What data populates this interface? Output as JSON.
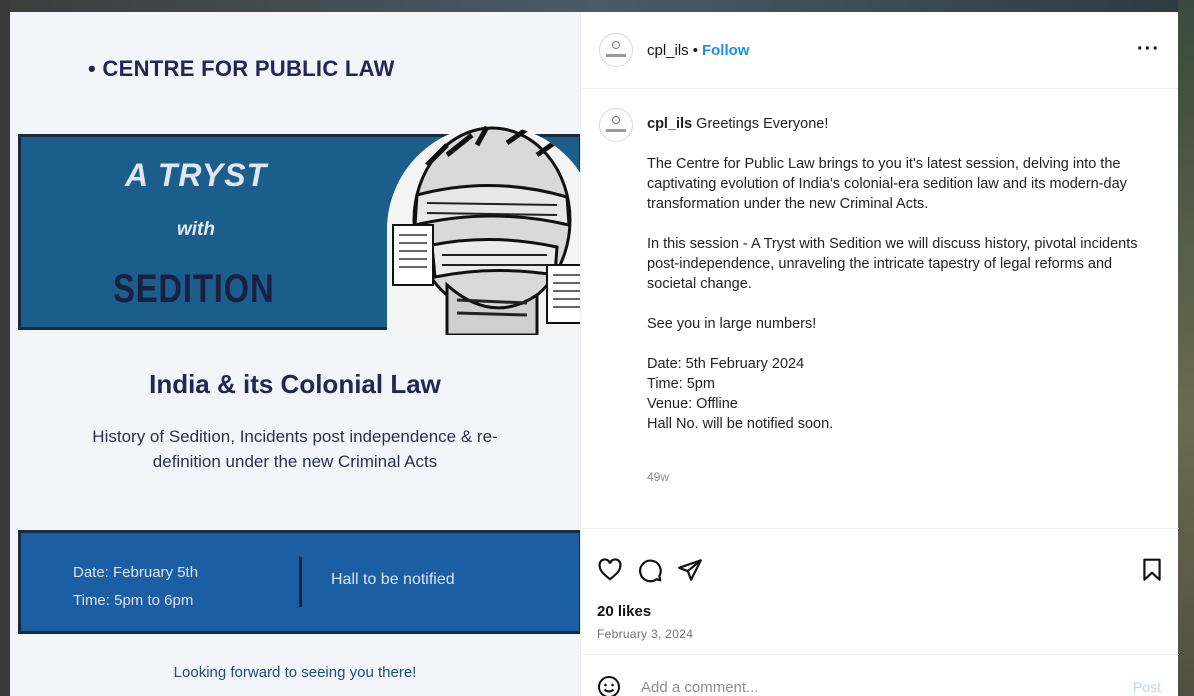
{
  "poster": {
    "header": "• CENTRE FOR PUBLIC LAW",
    "tryst": "A TRYST",
    "with": "with",
    "sedition": "SEDITION",
    "title": "India & its Colonial Law",
    "subtitle_line1": "History of Sedition, Incidents post independence & re-",
    "subtitle_line2": "definition under the new Criminal Acts",
    "date": "Date: February 5th",
    "time": "Time: 5pm to 6pm",
    "hall": "Hall to be notified",
    "footer": "Looking forward to seeing you there!"
  },
  "post": {
    "username": "cpl_ils",
    "follow_label": "Follow",
    "more_label": "···",
    "caption": {
      "username": "cpl_ils",
      "greeting": "Greetings Everyone!",
      "para1": "The Centre for Public Law brings to you it's latest session, delving into the captivating evolution of India's colonial-era sedition law and its modern-day transformation under the new Criminal Acts.",
      "para2": "In this session - A Tryst with Sedition we will discuss history, pivotal incidents post-independence, unraveling the intricate tapestry of legal reforms and societal change.",
      "para3": "See you in large numbers!",
      "date": "Date: 5th February 2024",
      "time": "Time: 5pm",
      "venue": "Venue: Offline",
      "hall": "Hall No. will be notified soon."
    },
    "age": "49w",
    "likes": "20 likes",
    "date": "February 3, 2024",
    "comment_placeholder": "Add a comment...",
    "post_label": "Post"
  },
  "icons": [
    "heart-icon",
    "comment-icon",
    "share-icon",
    "bookmark-icon",
    "emoji-icon"
  ],
  "colors": {
    "follow": "#1d8ee6",
    "banner": "#1b5e8c",
    "info_bar": "#1b5ea4",
    "poster_text": "#232557"
  }
}
